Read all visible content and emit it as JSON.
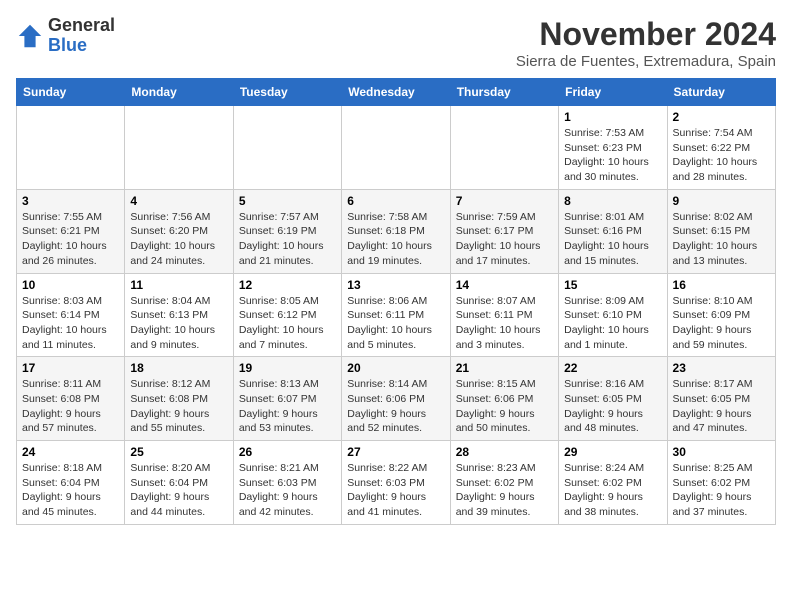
{
  "header": {
    "logo_general": "General",
    "logo_blue": "Blue",
    "month_year": "November 2024",
    "location": "Sierra de Fuentes, Extremadura, Spain"
  },
  "weekdays": [
    "Sunday",
    "Monday",
    "Tuesday",
    "Wednesday",
    "Thursday",
    "Friday",
    "Saturday"
  ],
  "weeks": [
    [
      {
        "day": "",
        "info": ""
      },
      {
        "day": "",
        "info": ""
      },
      {
        "day": "",
        "info": ""
      },
      {
        "day": "",
        "info": ""
      },
      {
        "day": "",
        "info": ""
      },
      {
        "day": "1",
        "info": "Sunrise: 7:53 AM\nSunset: 6:23 PM\nDaylight: 10 hours and 30 minutes."
      },
      {
        "day": "2",
        "info": "Sunrise: 7:54 AM\nSunset: 6:22 PM\nDaylight: 10 hours and 28 minutes."
      }
    ],
    [
      {
        "day": "3",
        "info": "Sunrise: 7:55 AM\nSunset: 6:21 PM\nDaylight: 10 hours and 26 minutes."
      },
      {
        "day": "4",
        "info": "Sunrise: 7:56 AM\nSunset: 6:20 PM\nDaylight: 10 hours and 24 minutes."
      },
      {
        "day": "5",
        "info": "Sunrise: 7:57 AM\nSunset: 6:19 PM\nDaylight: 10 hours and 21 minutes."
      },
      {
        "day": "6",
        "info": "Sunrise: 7:58 AM\nSunset: 6:18 PM\nDaylight: 10 hours and 19 minutes."
      },
      {
        "day": "7",
        "info": "Sunrise: 7:59 AM\nSunset: 6:17 PM\nDaylight: 10 hours and 17 minutes."
      },
      {
        "day": "8",
        "info": "Sunrise: 8:01 AM\nSunset: 6:16 PM\nDaylight: 10 hours and 15 minutes."
      },
      {
        "day": "9",
        "info": "Sunrise: 8:02 AM\nSunset: 6:15 PM\nDaylight: 10 hours and 13 minutes."
      }
    ],
    [
      {
        "day": "10",
        "info": "Sunrise: 8:03 AM\nSunset: 6:14 PM\nDaylight: 10 hours and 11 minutes."
      },
      {
        "day": "11",
        "info": "Sunrise: 8:04 AM\nSunset: 6:13 PM\nDaylight: 10 hours and 9 minutes."
      },
      {
        "day": "12",
        "info": "Sunrise: 8:05 AM\nSunset: 6:12 PM\nDaylight: 10 hours and 7 minutes."
      },
      {
        "day": "13",
        "info": "Sunrise: 8:06 AM\nSunset: 6:11 PM\nDaylight: 10 hours and 5 minutes."
      },
      {
        "day": "14",
        "info": "Sunrise: 8:07 AM\nSunset: 6:11 PM\nDaylight: 10 hours and 3 minutes."
      },
      {
        "day": "15",
        "info": "Sunrise: 8:09 AM\nSunset: 6:10 PM\nDaylight: 10 hours and 1 minute."
      },
      {
        "day": "16",
        "info": "Sunrise: 8:10 AM\nSunset: 6:09 PM\nDaylight: 9 hours and 59 minutes."
      }
    ],
    [
      {
        "day": "17",
        "info": "Sunrise: 8:11 AM\nSunset: 6:08 PM\nDaylight: 9 hours and 57 minutes."
      },
      {
        "day": "18",
        "info": "Sunrise: 8:12 AM\nSunset: 6:08 PM\nDaylight: 9 hours and 55 minutes."
      },
      {
        "day": "19",
        "info": "Sunrise: 8:13 AM\nSunset: 6:07 PM\nDaylight: 9 hours and 53 minutes."
      },
      {
        "day": "20",
        "info": "Sunrise: 8:14 AM\nSunset: 6:06 PM\nDaylight: 9 hours and 52 minutes."
      },
      {
        "day": "21",
        "info": "Sunrise: 8:15 AM\nSunset: 6:06 PM\nDaylight: 9 hours and 50 minutes."
      },
      {
        "day": "22",
        "info": "Sunrise: 8:16 AM\nSunset: 6:05 PM\nDaylight: 9 hours and 48 minutes."
      },
      {
        "day": "23",
        "info": "Sunrise: 8:17 AM\nSunset: 6:05 PM\nDaylight: 9 hours and 47 minutes."
      }
    ],
    [
      {
        "day": "24",
        "info": "Sunrise: 8:18 AM\nSunset: 6:04 PM\nDaylight: 9 hours and 45 minutes."
      },
      {
        "day": "25",
        "info": "Sunrise: 8:20 AM\nSunset: 6:04 PM\nDaylight: 9 hours and 44 minutes."
      },
      {
        "day": "26",
        "info": "Sunrise: 8:21 AM\nSunset: 6:03 PM\nDaylight: 9 hours and 42 minutes."
      },
      {
        "day": "27",
        "info": "Sunrise: 8:22 AM\nSunset: 6:03 PM\nDaylight: 9 hours and 41 minutes."
      },
      {
        "day": "28",
        "info": "Sunrise: 8:23 AM\nSunset: 6:02 PM\nDaylight: 9 hours and 39 minutes."
      },
      {
        "day": "29",
        "info": "Sunrise: 8:24 AM\nSunset: 6:02 PM\nDaylight: 9 hours and 38 minutes."
      },
      {
        "day": "30",
        "info": "Sunrise: 8:25 AM\nSunset: 6:02 PM\nDaylight: 9 hours and 37 minutes."
      }
    ]
  ]
}
